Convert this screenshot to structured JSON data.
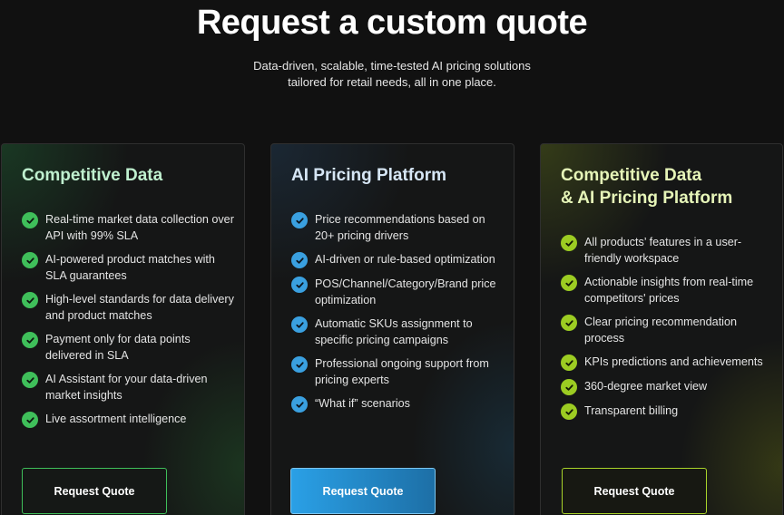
{
  "header": {
    "title": "Request a custom quote",
    "subtitle_line1": "Data-driven, scalable, time-tested AI pricing solutions",
    "subtitle_line2": "tailored for retail needs, all in one place."
  },
  "colors": {
    "card1_accent": "#3fbf5a",
    "card2_accent": "#3aa0e0",
    "card3_accent": "#9ccc22"
  },
  "cards": [
    {
      "title_line1": "Competitive Data",
      "title_line2": "",
      "features": [
        "Real-time market data collection over API with 99% SLA",
        "AI-powered product matches with SLA guarantees",
        "High-level standards for data delivery and product matches",
        "Payment only for data points delivered in SLA",
        "AI Assistant for your data-driven market insights",
        "Live assortment intelligence"
      ],
      "button_label": "Request Quote"
    },
    {
      "title_line1": "AI Pricing Platform",
      "title_line2": "",
      "features": [
        "Price recommendations based on 20+ pricing drivers",
        "AI-driven or rule-based optimization",
        "POS/Channel/Category/Brand price optimization",
        "Automatic SKUs assignment to specific pricing campaigns",
        "Professional ongoing support from pricing experts",
        "“What if” scenarios"
      ],
      "button_label": "Request Quote"
    },
    {
      "title_line1": "Competitive Data",
      "title_line2": "& AI Pricing Platform",
      "features": [
        "All products’ features in a user-friendly workspace",
        "Actionable insights from real-time competitors' prices",
        "Clear pricing recommendation process",
        "KPIs predictions and achievements",
        "360-degree market view",
        "Transparent billing"
      ],
      "button_label": "Request Quote"
    }
  ]
}
